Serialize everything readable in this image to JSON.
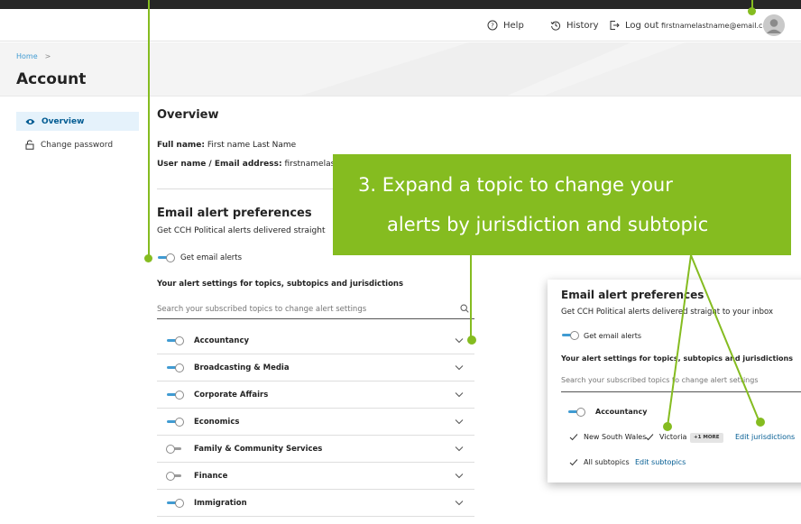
{
  "header": {
    "help": "Help",
    "history": "History",
    "logout": "Log out",
    "email": "firstnamelastname@email.com"
  },
  "breadcrumb": {
    "home": "Home",
    "separator": ">"
  },
  "page_title": "Account",
  "sidebar": {
    "items": [
      {
        "label": "Overview",
        "active": true
      },
      {
        "label": "Change password",
        "active": false
      }
    ]
  },
  "overview": {
    "title": "Overview",
    "full_name_label": "Full name:",
    "full_name_value": "First name Last Name",
    "email_label": "User name / Email address:",
    "email_value": "firstnamelastn"
  },
  "alerts": {
    "title": "Email alert preferences",
    "subtitle": "Get CCH Political alerts delivered straight",
    "toggle_label": "Get email alerts",
    "settings_label": "Your alert settings for topics, subtopics and jurisdictions",
    "search_placeholder": "Search your subscribed topics to change alert settings",
    "topics": [
      {
        "label": "Accountancy",
        "on": true
      },
      {
        "label": "Broadcasting & Media",
        "on": true
      },
      {
        "label": "Corporate Affairs",
        "on": true
      },
      {
        "label": "Economics",
        "on": true
      },
      {
        "label": "Family & Community Services",
        "on": false
      },
      {
        "label": "Finance",
        "on": false
      },
      {
        "label": "Immigration",
        "on": true
      }
    ]
  },
  "callout": {
    "line1": "3. Expand a topic to change your",
    "line2": "alerts by jurisdiction and subtopic"
  },
  "panel": {
    "title": "Email alert preferences",
    "subtitle": "Get CCH Political alerts delivered straight to your inbox",
    "toggle_label": "Get email alerts",
    "settings_label": "Your alert settings for topics, subtopics and jurisdictions",
    "search_placeholder": "Search your subscribed topics to change alert settings",
    "topic": "Accountancy",
    "jurisdiction_1": "New South Wales",
    "jurisdiction_2": "Victoria",
    "more_badge": "+1 MORE",
    "edit_jurisdictions": "Edit jurisdictions",
    "subtopics": "All subtopics",
    "edit_subtopics": "Edit subtopics"
  },
  "colors": {
    "accent_green": "#85bc20",
    "brand_blue": "#409bd2",
    "dark_bar": "#262626"
  },
  "icons": [
    "help-icon",
    "history-icon",
    "logout-icon",
    "avatar-icon",
    "eye-icon",
    "lock-icon",
    "search-icon",
    "chevron-down-icon",
    "check-icon"
  ]
}
